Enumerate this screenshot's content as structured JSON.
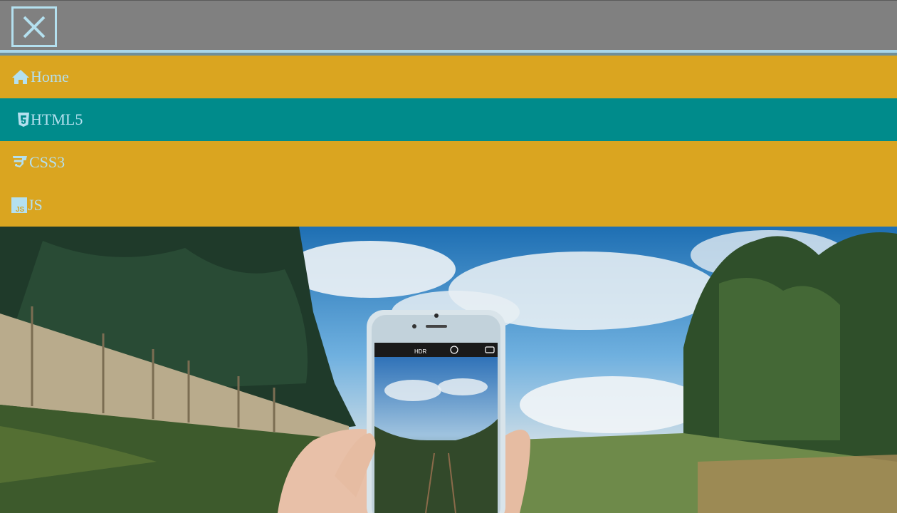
{
  "header": {
    "close_icon": "close-icon"
  },
  "menu": {
    "items": [
      {
        "label": "Home",
        "icon": "home-icon"
      },
      {
        "label": "HTML5",
        "icon": "html5-icon",
        "active": true
      },
      {
        "label": "CSS3",
        "icon": "css3-icon"
      },
      {
        "label": "JS",
        "icon": "js-icon"
      }
    ]
  },
  "hero": {
    "phone_status": "HDR"
  },
  "colors": {
    "topbar": "#808080",
    "accent_border": "#a9d6ea",
    "menu_bg": "#daa520",
    "menu_active_bg": "#008b8b",
    "menu_text": "#b4e0ef"
  }
}
